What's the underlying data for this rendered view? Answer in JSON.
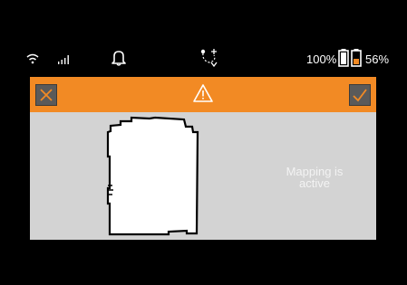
{
  "status_bar": {
    "icons": [
      "wifi-icon",
      "signal-icon",
      "bell-icon",
      "route-icon",
      "battery-icon"
    ],
    "battery_primary": "100%",
    "battery_secondary": "56%"
  },
  "header": {
    "color": "#f28a24",
    "cancel_icon": "close-icon",
    "warning_icon": "warning-icon",
    "confirm_icon": "check-icon"
  },
  "content": {
    "status_text": "Mapping is\nactive"
  }
}
